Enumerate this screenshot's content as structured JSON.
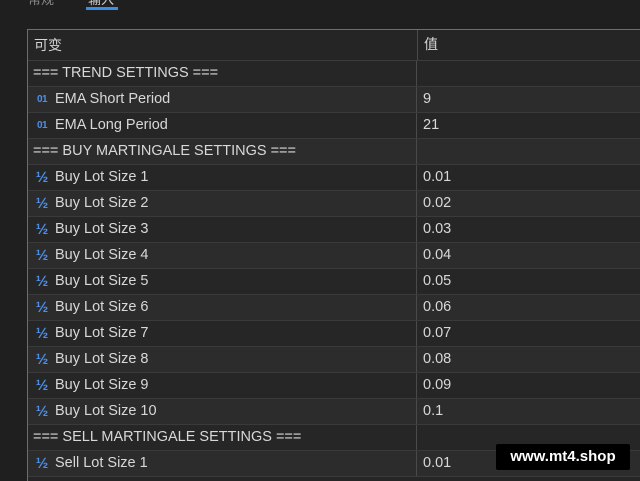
{
  "tabs": [
    {
      "label": "常规"
    },
    {
      "label": "输入"
    }
  ],
  "table": {
    "headers": {
      "variable": "可变",
      "value": "值"
    },
    "rows": [
      {
        "type": "section",
        "label": "=== TREND SETTINGS ===",
        "value": ""
      },
      {
        "type": "int",
        "icon": "01",
        "label": "EMA Short Period",
        "value": "9"
      },
      {
        "type": "int",
        "icon": "01",
        "label": "EMA Long Period",
        "value": "21"
      },
      {
        "type": "section",
        "label": "=== BUY MARTINGALE SETTINGS ===",
        "value": ""
      },
      {
        "type": "double",
        "icon": "½",
        "label": "Buy Lot Size 1",
        "value": "0.01"
      },
      {
        "type": "double",
        "icon": "½",
        "label": "Buy Lot Size 2",
        "value": "0.02"
      },
      {
        "type": "double",
        "icon": "½",
        "label": "Buy Lot Size 3",
        "value": "0.03"
      },
      {
        "type": "double",
        "icon": "½",
        "label": "Buy Lot Size 4",
        "value": "0.04"
      },
      {
        "type": "double",
        "icon": "½",
        "label": "Buy Lot Size 5",
        "value": "0.05"
      },
      {
        "type": "double",
        "icon": "½",
        "label": "Buy Lot Size 6",
        "value": "0.06"
      },
      {
        "type": "double",
        "icon": "½",
        "label": "Buy Lot Size 7",
        "value": "0.07"
      },
      {
        "type": "double",
        "icon": "½",
        "label": "Buy Lot Size 8",
        "value": "0.08"
      },
      {
        "type": "double",
        "icon": "½",
        "label": "Buy Lot Size 9",
        "value": "0.09"
      },
      {
        "type": "double",
        "icon": "½",
        "label": "Buy Lot Size 10",
        "value": "0.1"
      },
      {
        "type": "section",
        "label": "=== SELL MARTINGALE SETTINGS ===",
        "value": ""
      },
      {
        "type": "double",
        "icon": "½",
        "label": "Sell Lot Size 1",
        "value": "0.01"
      }
    ]
  },
  "watermark": "www.mt4.shop",
  "colors": {
    "accent": "#3a8ee6",
    "icon": "#4d8ee8",
    "background": "#262626"
  }
}
